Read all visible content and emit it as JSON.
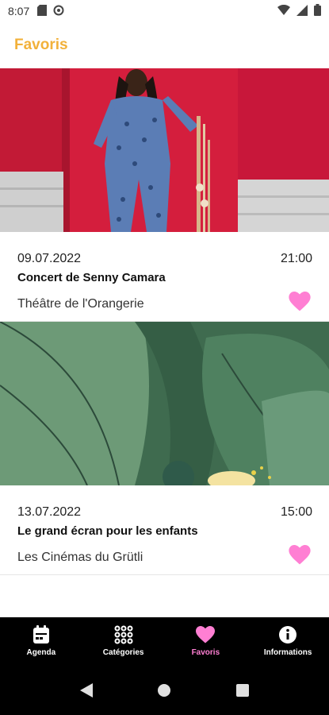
{
  "status_bar": {
    "time": "8:07",
    "icons": [
      "sd-card-icon",
      "sync-icon",
      "wifi-icon",
      "signal-icon",
      "battery-icon"
    ]
  },
  "header": {
    "title": "Favoris",
    "title_color": "#f2b13a"
  },
  "events": [
    {
      "image": "musician-photo",
      "date": "09.07.2022",
      "time": "21:00",
      "title": "Concert de Senny Camara",
      "venue": "Théâtre de l'Orangerie",
      "favorite": true
    },
    {
      "image": "leaves-illustration",
      "date": "13.07.2022",
      "time": "15:00",
      "title": "Le grand écran pour les enfants",
      "venue": "Les Cinémas du Grütli",
      "favorite": true
    }
  ],
  "bottom_nav": {
    "items": [
      {
        "label": "Agenda",
        "icon": "calendar-icon",
        "active": false
      },
      {
        "label": "Catégories",
        "icon": "grid-icon",
        "active": false
      },
      {
        "label": "Favoris",
        "icon": "heart-icon",
        "active": true
      },
      {
        "label": "Informations",
        "icon": "info-icon",
        "active": false
      }
    ]
  },
  "colors": {
    "accent": "#f2b13a",
    "favorite": "#ff7fd3",
    "nav_background": "#000000"
  }
}
